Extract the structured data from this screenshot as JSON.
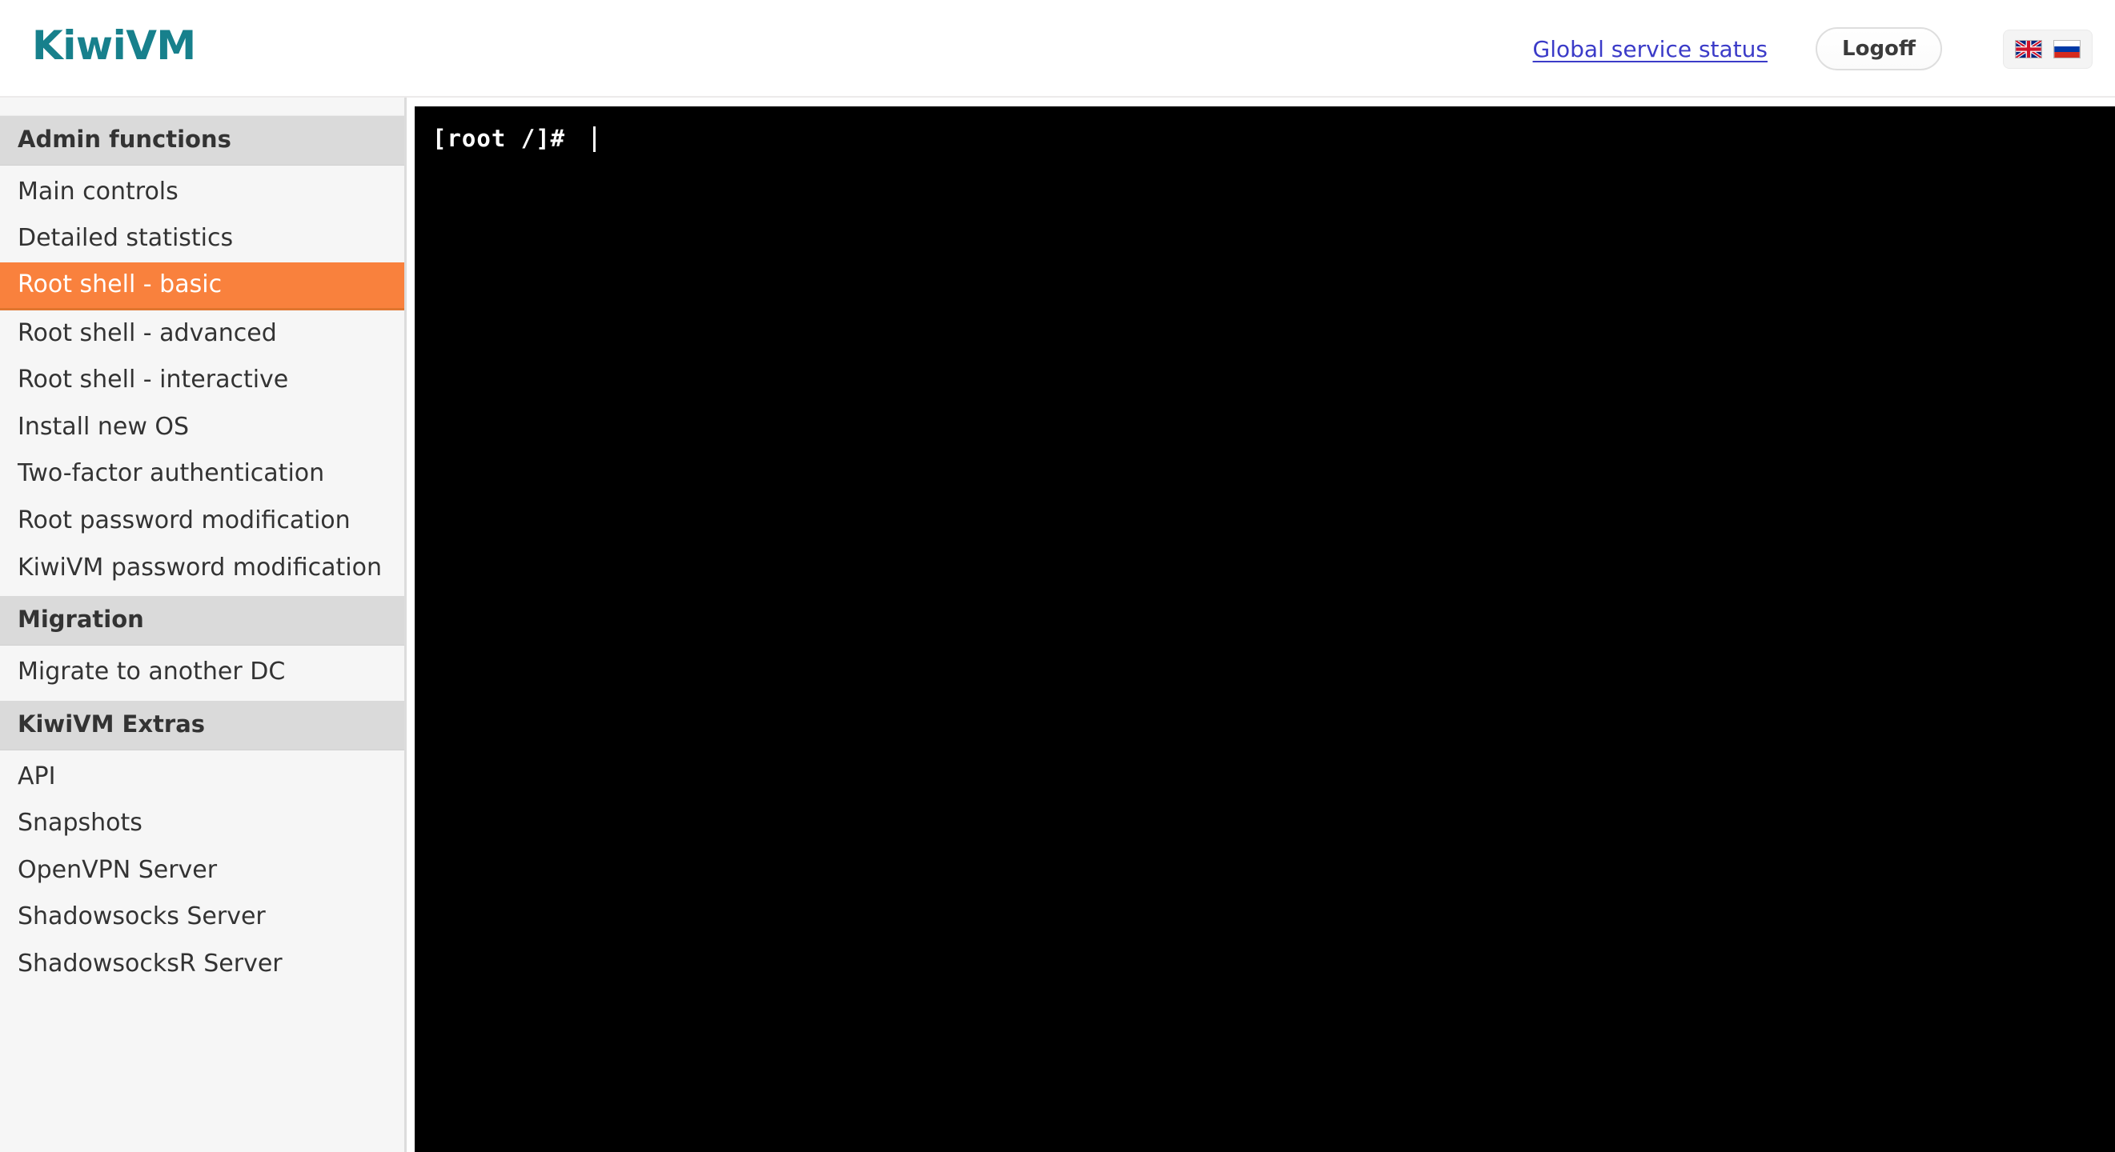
{
  "header": {
    "brand": "KiwiVM",
    "status_link": "Global service status",
    "logoff_label": "Logoff",
    "languages": [
      {
        "name": "english-flag",
        "title": "English"
      },
      {
        "name": "russian-flag",
        "title": "Русский"
      }
    ],
    "brand_color": "#17808c",
    "link_color": "#3b3bc8"
  },
  "sidebar": {
    "accent_color": "#f9813d",
    "sections": [
      {
        "title": "Admin functions",
        "items": [
          {
            "label": "Main controls",
            "active": false
          },
          {
            "label": "Detailed statistics",
            "active": false
          },
          {
            "label": "Root shell - basic",
            "active": true
          },
          {
            "label": "Root shell - advanced",
            "active": false
          },
          {
            "label": "Root shell - interactive",
            "active": false
          },
          {
            "label": "Install new OS",
            "active": false
          },
          {
            "label": "Two-factor authentication",
            "active": false
          },
          {
            "label": "Root password modification",
            "active": false
          },
          {
            "label": "KiwiVM password modification",
            "active": false
          }
        ]
      },
      {
        "title": "Migration",
        "items": [
          {
            "label": "Migrate to another DC",
            "active": false
          }
        ]
      },
      {
        "title": "KiwiVM Extras",
        "items": [
          {
            "label": "API",
            "active": false
          },
          {
            "label": "Snapshots",
            "active": false
          },
          {
            "label": "OpenVPN Server",
            "active": false
          },
          {
            "label": "Shadowsocks Server",
            "active": false
          },
          {
            "label": "ShadowsocksR Server",
            "active": false
          }
        ]
      }
    ]
  },
  "terminal": {
    "prompt": "[root /]# ",
    "background": "#000000",
    "foreground": "#ffffff"
  }
}
